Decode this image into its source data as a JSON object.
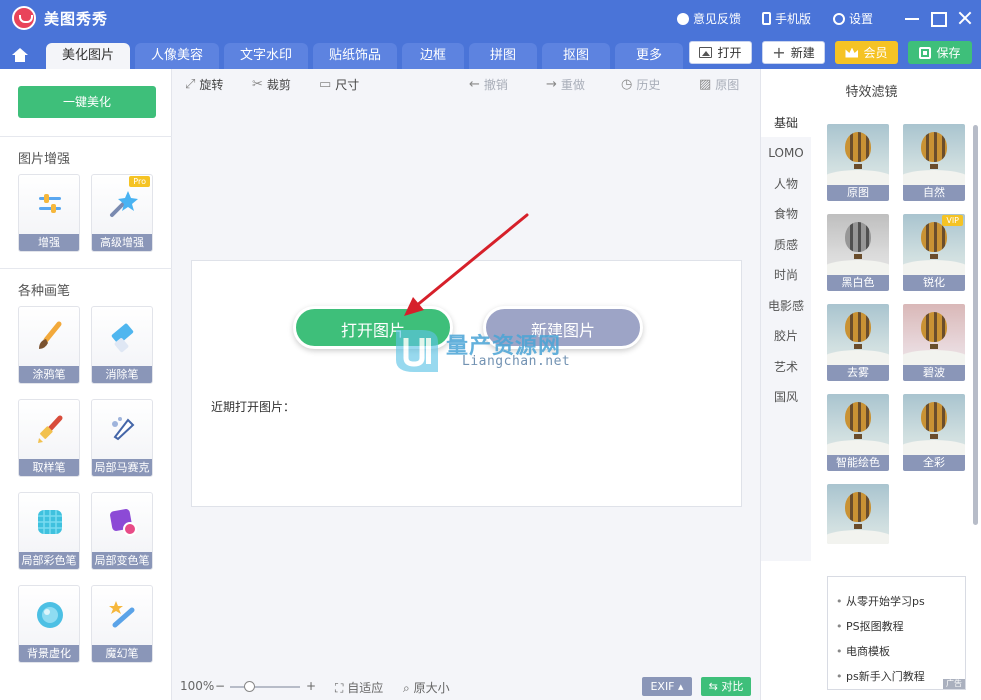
{
  "app": {
    "title": "美图秀秀",
    "feedback": "意见反馈",
    "mobile": "手机版",
    "settings": "设置"
  },
  "tabs": [
    "美化图片",
    "人像美容",
    "文字水印",
    "贴纸饰品",
    "边框",
    "拼图",
    "抠图",
    "更多"
  ],
  "top_buttons": {
    "open": "打开",
    "new": "新建",
    "vip": "会员",
    "save": "保存"
  },
  "left": {
    "one_click": "一键美化",
    "enhance_title": "图片增强",
    "enhance_tools": [
      {
        "label": "增强",
        "icon": "sliders-icon"
      },
      {
        "label": "高级增强",
        "icon": "magic-wand-icon",
        "badge": "Pro"
      }
    ],
    "brush_title": "各种画笔",
    "brush_tools": [
      {
        "label": "涂鸦笔",
        "icon": "paint-brush-icon"
      },
      {
        "label": "消除笔",
        "icon": "eraser-icon"
      },
      {
        "label": "取样笔",
        "icon": "sample-brush-icon"
      },
      {
        "label": "局部马赛克",
        "icon": "mosaic-pen-icon"
      },
      {
        "label": "局部彩色笔",
        "icon": "color-brush-icon"
      },
      {
        "label": "局部变色笔",
        "icon": "recolor-brush-icon"
      },
      {
        "label": "背景虚化",
        "icon": "blur-background-icon"
      },
      {
        "label": "魔幻笔",
        "icon": "magic-pen-icon"
      }
    ]
  },
  "toolbar": {
    "rotate": "旋转",
    "crop": "裁剪",
    "size": "尺寸",
    "undo": "撤销",
    "redo": "重做",
    "history": "历史",
    "original": "原图"
  },
  "canvas": {
    "open_image": "打开图片",
    "new_image": "新建图片",
    "recent": "近期打开图片："
  },
  "watermark": {
    "cn": "量产资源网",
    "en": "Liangchan.net"
  },
  "status": {
    "zoom": "100%",
    "fit": "自适应",
    "actual": "原大小",
    "exif": "EXIF",
    "compare": "对比"
  },
  "right": {
    "title": "特效滤镜",
    "categories": [
      "基础",
      "LOMO",
      "人物",
      "食物",
      "质感",
      "时尚",
      "电影感",
      "胶片",
      "艺术",
      "国风"
    ],
    "filters": [
      {
        "label": "原图"
      },
      {
        "label": "自然"
      },
      {
        "label": "黑白色"
      },
      {
        "label": "锐化",
        "badge": "VIP"
      },
      {
        "label": "去雾"
      },
      {
        "label": "碧波"
      },
      {
        "label": "智能绘色"
      },
      {
        "label": "全彩"
      },
      {
        "label": ""
      }
    ],
    "ads": [
      "从零开始学习ps",
      "PS抠图教程",
      "电商模板",
      "ps新手入门教程"
    ],
    "ad_tag": "广告"
  },
  "colors": {
    "brand_blue": "#4a74d8",
    "green": "#3ebf7a",
    "gold": "#f5c324",
    "label_gray": "#8a96b8",
    "arrow_red": "#d6202a"
  }
}
